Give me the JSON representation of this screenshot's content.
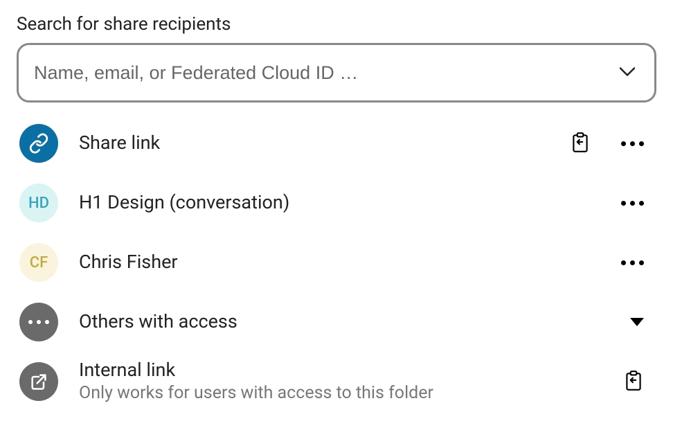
{
  "search": {
    "label": "Search for share recipients",
    "placeholder": "Name, email, or Federated Cloud ID …"
  },
  "rows": {
    "shareLink": {
      "title": "Share link"
    },
    "h1design": {
      "initials": "HD",
      "title": "H1 Design (conversation)"
    },
    "chrisFisher": {
      "initials": "CF",
      "title": "Chris Fisher"
    },
    "othersAccess": {
      "title": "Others with access"
    },
    "internalLink": {
      "title": "Internal link",
      "subtitle": "Only works for users with access to this folder"
    }
  }
}
